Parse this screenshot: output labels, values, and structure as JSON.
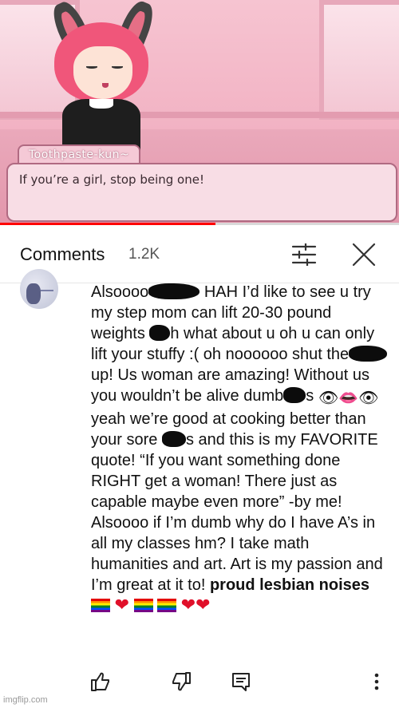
{
  "video": {
    "speaker_name": "Toothpaste-kun~",
    "dialogue": "If you’re a girl, stop being one!",
    "progress_fraction": 0.54
  },
  "comments_header": {
    "title": "Comments",
    "count": "1.2K",
    "filter_icon": "sort-filter-icon",
    "close_icon": "close-icon"
  },
  "comment": {
    "segments": [
      "Alsoooo",
      "HAH I’d like to see u try my step mom can lift 20-30 pound weights",
      "h what about u oh u can only lift your stuffy :( oh noooooo shut the",
      "up! Us woman are amazing! Without us you wouldn’t be alive dumb",
      "s",
      "yeah we’re good at cooking better than your sore",
      "s and this is my FAVORITE quote! “If you want something done RIGHT get a woman! There just as capable maybe even more” -by me! Alsoooo if I’m dumb why do I have A’s in all my classes hm? I take math humanities and art. Art is my passion and I’m great at it to!",
      "proud lesbian noises"
    ],
    "eye_emoji": "👁",
    "lips_emoji": "👄",
    "heart": "❤"
  },
  "actions": {
    "like_icon": "thumbs-up-icon",
    "dislike_icon": "thumbs-down-icon",
    "reply_icon": "reply-icon",
    "more_icon": "more-vert-icon"
  },
  "watermark": "imgflip.com"
}
